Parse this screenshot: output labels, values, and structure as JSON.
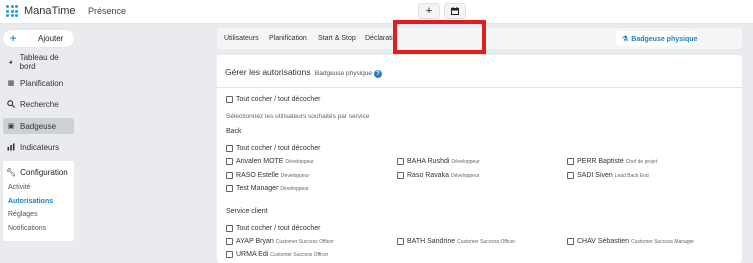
{
  "topbar": {
    "app_name": "ManaTime",
    "page_title": "Présence",
    "add_icon": "plus-icon",
    "calendar_icon": "calendar-icon"
  },
  "sidebar": {
    "add_label": "Ajouter",
    "items": [
      {
        "label": "Tableau de bord",
        "icon": "dashboard-icon"
      },
      {
        "label": "Planification",
        "icon": "calendar-icon"
      },
      {
        "label": "Recherche",
        "icon": "search-icon"
      },
      {
        "label": "Badgeuse",
        "icon": "badge-icon",
        "active": true
      },
      {
        "label": "Indicateurs",
        "icon": "chart-icon"
      }
    ],
    "config": {
      "label": "Configuration",
      "icon": "wrench-icon",
      "subitems": [
        {
          "label": "Activité"
        },
        {
          "label": "Autorisations",
          "selected": true
        },
        {
          "label": "Réglages"
        },
        {
          "label": "Notifications"
        }
      ]
    }
  },
  "tabs": [
    {
      "label": "Utilisateurs"
    },
    {
      "label": "Planification"
    },
    {
      "label": "Start & Stop"
    },
    {
      "label": "Déclarati"
    },
    {
      "label": "Badgeuse physique",
      "active": true
    }
  ],
  "panel": {
    "title": "Gérer les autorisations",
    "subtitle": "Badgeuse physique",
    "help": "?",
    "check_all": "Tout cocher / tout décocher",
    "hint": "Sélectionnez les utilisateurs souhaités par service",
    "sections": [
      {
        "name": "Back",
        "check_all": "Tout cocher / tout décocher",
        "users": [
          {
            "name": "Arivalen MOTE",
            "role": "Développeur"
          },
          {
            "name": "BAHA Rushdi",
            "role": "Développeur"
          },
          {
            "name": "PERR Baptiste",
            "role": "Chef de projet"
          },
          {
            "name": "RASO Estelle",
            "role": "Développeur"
          },
          {
            "name": "Raso Ravaka",
            "role": "Développeur"
          },
          {
            "name": "SADI Siven",
            "role": "Lead Back End"
          },
          {
            "name": "Test Manager",
            "role": "Développeur"
          }
        ]
      },
      {
        "name": "Service client",
        "check_all": "Tout cocher / tout décocher",
        "users": [
          {
            "name": "AYAP Bryan",
            "role": "Customer Success Officer"
          },
          {
            "name": "BATH Sandrine",
            "role": "Customer Success Officer"
          },
          {
            "name": "CHAV Sébastien",
            "role": "Customer Success Manager"
          },
          {
            "name": "URMA Edi",
            "role": "Customer Success Officer"
          }
        ]
      }
    ]
  },
  "colors": {
    "accent": "#1f80c9",
    "highlight": "#e01e1e"
  }
}
